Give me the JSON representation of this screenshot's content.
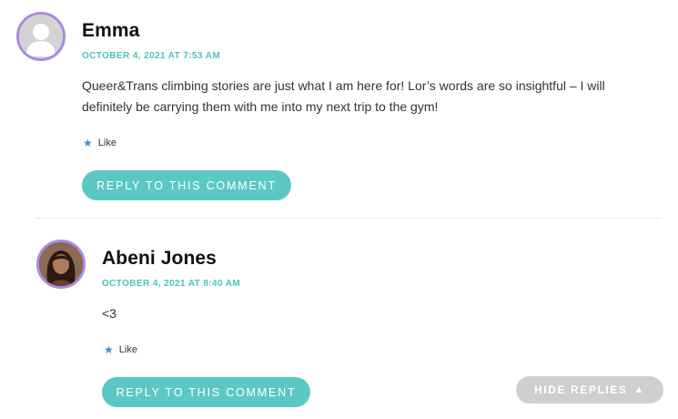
{
  "comments": [
    {
      "author": "Emma",
      "date": "OCTOBER 4, 2021 AT 7:53 AM",
      "text": "Queer&Trans climbing stories are just what I am here for! Lor’s words are so insightful – I will definitely be carrying them with me into my next trip to the gym!",
      "like_label": "Like",
      "reply_label": "REPLY TO THIS COMMENT"
    },
    {
      "author": "Abeni Jones",
      "date": "OCTOBER 4, 2021 AT 8:40 AM",
      "text": "<3",
      "like_label": "Like",
      "reply_label": "REPLY TO THIS COMMENT"
    }
  ],
  "hide_replies_label": "HIDE REPLIES",
  "icons": {
    "like": "star-icon",
    "hide": "triangle-up-icon",
    "avatar_default": "person-silhouette-icon"
  },
  "colors": {
    "accent": "#5cc8c3",
    "date": "#4fc1bb",
    "avatar_ring": "#a98be0",
    "hide_button": "#cfcfcf"
  }
}
